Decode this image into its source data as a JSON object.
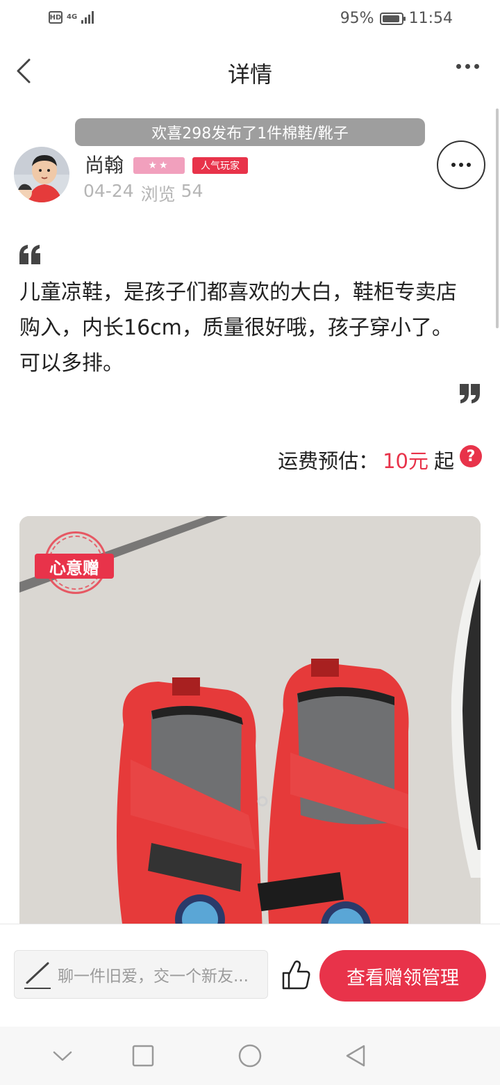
{
  "status_bar": {
    "hd_label": "HD",
    "network_label": "4G",
    "battery_percent": "95%",
    "battery_level": 0.95,
    "time": "11:54"
  },
  "nav": {
    "title": "详情",
    "back_icon": "chevron-left-icon",
    "more_icon": "more-horizontal-icon"
  },
  "notice": {
    "text": "欢喜298发布了1件棉鞋/靴子"
  },
  "user": {
    "name": "尚翰",
    "star_badge": "★★",
    "popular_badge": "人气玩家",
    "date": "04-24",
    "views_label": "浏览",
    "views_count": "54"
  },
  "post": {
    "description": "儿童凉鞋，是孩子们都喜欢的大白，鞋柜专卖店购入，内长16cm，质量很好哦，孩子穿小了。可以多排。"
  },
  "shipping": {
    "label": "运费预估：",
    "price": "10元",
    "suffix": "起",
    "help_symbol": "?"
  },
  "photo": {
    "stamp_label": "心意赠"
  },
  "action_bar": {
    "comment_placeholder": "聊一件旧爱，交一个新友...",
    "claim_button": "查看赠领管理"
  },
  "colors": {
    "accent": "#e8334a",
    "notice_bg": "#9e9e9e",
    "star_badge_bg": "#f1a0bd",
    "muted_text": "#b5b5b5"
  }
}
